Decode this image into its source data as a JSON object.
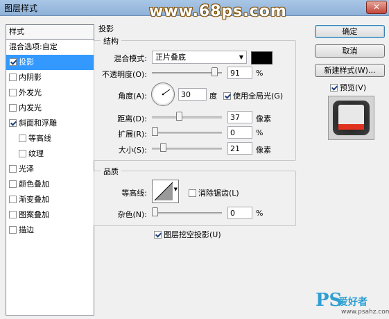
{
  "window": {
    "title": "图层样式",
    "watermark": "www.68ps.com",
    "close_glyph": "✕"
  },
  "styles_panel": {
    "header": "样式",
    "blend_options": "混合选项:自定",
    "items": [
      {
        "label": "投影",
        "checked": true,
        "selected": true,
        "indent": false
      },
      {
        "label": "内阴影",
        "checked": false,
        "selected": false,
        "indent": false
      },
      {
        "label": "外发光",
        "checked": false,
        "selected": false,
        "indent": false
      },
      {
        "label": "内发光",
        "checked": false,
        "selected": false,
        "indent": false
      },
      {
        "label": "斜面和浮雕",
        "checked": true,
        "selected": false,
        "indent": false
      },
      {
        "label": "等高线",
        "checked": false,
        "selected": false,
        "indent": true
      },
      {
        "label": "纹理",
        "checked": false,
        "selected": false,
        "indent": true
      },
      {
        "label": "光泽",
        "checked": false,
        "selected": false,
        "indent": false
      },
      {
        "label": "颜色叠加",
        "checked": false,
        "selected": false,
        "indent": false
      },
      {
        "label": "渐变叠加",
        "checked": false,
        "selected": false,
        "indent": false
      },
      {
        "label": "图案叠加",
        "checked": false,
        "selected": false,
        "indent": false
      },
      {
        "label": "描边",
        "checked": false,
        "selected": false,
        "indent": false
      }
    ]
  },
  "drop_shadow": {
    "section_title": "投影",
    "structure": {
      "title": "结构",
      "blend_mode_label": "混合模式:",
      "blend_mode_value": "正片叠底",
      "shadow_color": "#000000",
      "opacity_label": "不透明度(O):",
      "opacity_value": "91",
      "opacity_unit": "%",
      "angle_label": "角度(A):",
      "angle_value": "30",
      "angle_unit": "度",
      "global_light_label": "使用全局光(G)",
      "global_light_checked": true,
      "distance_label": "距离(D):",
      "distance_value": "37",
      "distance_unit": "像素",
      "spread_label": "扩展(R):",
      "spread_value": "0",
      "spread_unit": "%",
      "size_label": "大小(S):",
      "size_value": "21",
      "size_unit": "像素"
    },
    "quality": {
      "title": "品质",
      "contour_label": "等高线:",
      "antialias_label": "消除锯齿(L)",
      "antialias_checked": false,
      "noise_label": "杂色(N):",
      "noise_value": "0",
      "noise_unit": "%"
    },
    "knockout_label": "图层挖空投影(U)",
    "knockout_checked": true
  },
  "buttons": {
    "ok": "确定",
    "cancel": "取消",
    "new_style": "新建样式(W)...",
    "preview_label": "预览(V)",
    "preview_checked": true
  },
  "footer_watermark": {
    "mark": "PS",
    "text": "爱好者",
    "url": "www.psahz.com"
  }
}
